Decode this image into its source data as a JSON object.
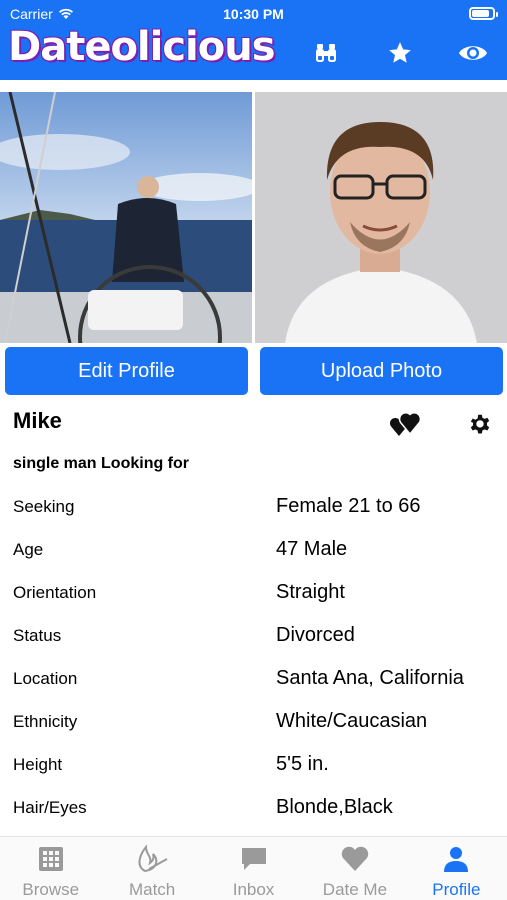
{
  "status_bar": {
    "carrier": "Carrier",
    "time": "10:30 PM",
    "battery_level": 0.85
  },
  "header": {
    "app_title": "Dateolicious",
    "icons": [
      "binoculars-icon",
      "star-icon",
      "eye-icon"
    ]
  },
  "photos": [
    "man-on-boat-photo",
    "man-with-glasses-photo"
  ],
  "actions": {
    "edit_profile": "Edit Profile",
    "upload_photo": "Upload Photo"
  },
  "profile": {
    "name": "Mike",
    "headline": "single man Looking for",
    "fields": [
      {
        "label": "Seeking",
        "value": "Female 21 to 66"
      },
      {
        "label": "Age",
        "value": "47 Male"
      },
      {
        "label": "Orientation",
        "value": "Straight"
      },
      {
        "label": "Status",
        "value": "Divorced"
      },
      {
        "label": "Location",
        "value": "Santa Ana, California"
      },
      {
        "label": "Ethnicity",
        "value": "White/Caucasian"
      },
      {
        "label": "Height",
        "value": "5'5 in."
      },
      {
        "label": "Hair/Eyes",
        "value": "Blonde,Black"
      }
    ]
  },
  "tabs": [
    {
      "label": "Browse",
      "icon": "grid-icon",
      "active": false
    },
    {
      "label": "Match",
      "icon": "flame-icon",
      "active": false
    },
    {
      "label": "Inbox",
      "icon": "chat-bubble-icon",
      "active": false
    },
    {
      "label": "Date Me",
      "icon": "heart-icon",
      "active": false
    },
    {
      "label": "Profile",
      "icon": "person-icon",
      "active": true
    }
  ],
  "colors": {
    "primary": "#1a73f5",
    "brand_outline": "#7c1fb0",
    "tab_inactive": "#9a9a9a"
  }
}
